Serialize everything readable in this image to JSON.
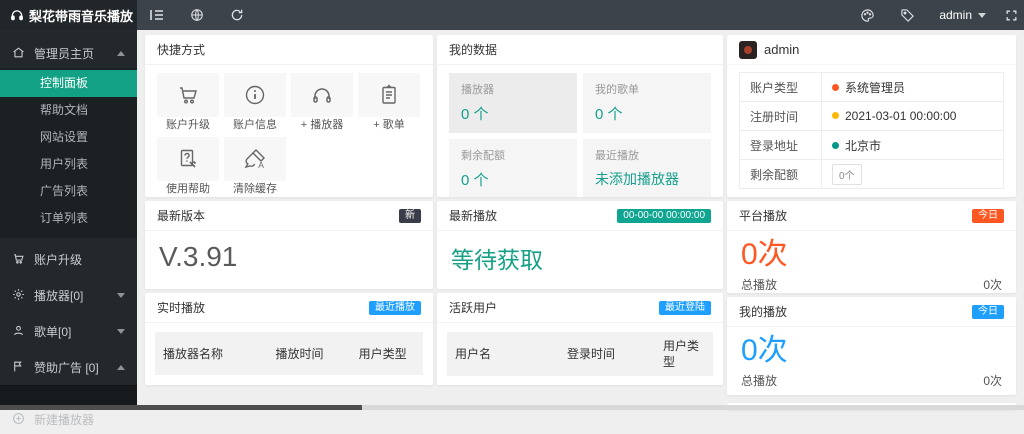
{
  "brand": {
    "title": "梨花带雨音乐播放"
  },
  "topbar": {
    "username": "admin"
  },
  "colors": {
    "accent_teal": "#16a085",
    "accent_orange": "#ff5722",
    "accent_blue": "#1e9fff",
    "accent_yellow": "#ffb800",
    "badge_dark": "#393d49",
    "sidebar_bg": "#23282c",
    "topbar_bg": "#3c434b"
  },
  "sidebar": {
    "group_admin": {
      "label": "管理员主页",
      "items": [
        {
          "label": "控制面板"
        },
        {
          "label": "帮助文档"
        },
        {
          "label": "网站设置"
        },
        {
          "label": "用户列表"
        },
        {
          "label": "广告列表"
        },
        {
          "label": "订单列表"
        }
      ],
      "active_item": "控制面板"
    },
    "account_upgrade": {
      "label": "账户升级"
    },
    "players": {
      "label": "播放器[0]"
    },
    "playlists": {
      "label": "歌单[0]"
    },
    "sponsor_ads": {
      "label": "赞助广告 [0]"
    },
    "new_player": {
      "label": "新建播放器"
    }
  },
  "shortcuts": {
    "title": "快捷方式",
    "items": [
      {
        "icon": "cart-icon",
        "label": "账户升级"
      },
      {
        "icon": "info-icon",
        "label": "账户信息"
      },
      {
        "icon": "headphones-icon",
        "label": "+ 播放器"
      },
      {
        "icon": "playlist-icon",
        "label": "+ 歌单"
      },
      {
        "icon": "help-icon",
        "label": "使用帮助"
      },
      {
        "icon": "brush-icon",
        "label": "清除缓存"
      }
    ]
  },
  "my_data": {
    "title": "我的数据",
    "stats": [
      {
        "label": "播放器",
        "value": "0 个"
      },
      {
        "label": "我的歌单",
        "value": "0 个"
      },
      {
        "label": "剩余配额",
        "value": "0 个"
      },
      {
        "label": "最近播放",
        "value": "未添加播放器"
      }
    ]
  },
  "profile": {
    "username": "admin",
    "rows": [
      {
        "label": "账户类型",
        "value": "系统管理员",
        "dot_color": "#ff5722"
      },
      {
        "label": "注册时间",
        "value": "2021-03-01 00:00:00",
        "dot_color": "#ffb800"
      },
      {
        "label": "登录地址",
        "value": "北京市",
        "dot_color": "#009688"
      },
      {
        "label": "剩余配额",
        "value": "0个"
      }
    ]
  },
  "latest_version": {
    "title": "最新版本",
    "badge": "新",
    "value": "V.3.91"
  },
  "latest_play": {
    "title": "最新播放",
    "badge": "00-00-00 00:00:00",
    "value": "等待获取"
  },
  "platform_play": {
    "title": "平台播放",
    "badge": "今日",
    "count": "0次",
    "total_label": "总播放",
    "total_value": "0次"
  },
  "realtime_play": {
    "title": "实时播放",
    "badge": "最近播放",
    "columns": [
      "播放器名称",
      "播放时间",
      "用户类型"
    ]
  },
  "active_users": {
    "title": "活跃用户",
    "badge": "最近登陆",
    "columns": [
      "用户名",
      "登录时间",
      "用户类型"
    ]
  },
  "my_play": {
    "title": "我的播放",
    "badge": "今日",
    "count": "0次",
    "total_label": "总播放",
    "total_value": "0次"
  }
}
